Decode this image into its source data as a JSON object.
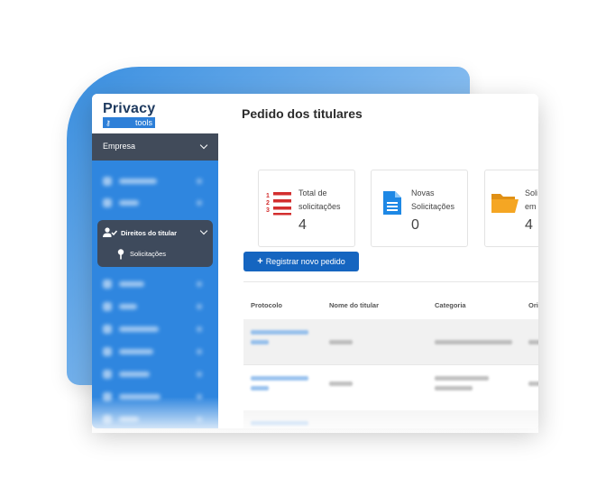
{
  "app": {
    "logo_title": "Privacy",
    "logo_subtitle": "tools",
    "page_title": "Pedido dos titulares"
  },
  "sidebar": {
    "company_label": "Empresa",
    "active_group": {
      "label": "Direitos do titular",
      "sub_item": "Solicitações"
    }
  },
  "cards": [
    {
      "label": "Total de solicitações",
      "value": "4",
      "icon": "list-numbered-icon"
    },
    {
      "label": "Novas Solicitações",
      "value": "0",
      "icon": "document-icon"
    },
    {
      "label": "Soli em",
      "value": "4",
      "icon": "folder-open-icon"
    }
  ],
  "register_button": "Registrar novo pedido",
  "table": {
    "headers": [
      "Protocolo",
      "Nome do titular",
      "Categoria",
      "Ori"
    ]
  },
  "colors": {
    "brand_blue": "#2f86df",
    "dark_panel": "#414b5a",
    "button_blue": "#1565c0",
    "list_icon_red": "#d32f2f",
    "doc_icon_blue": "#1e88e5",
    "folder_orange": "#f5a623"
  }
}
